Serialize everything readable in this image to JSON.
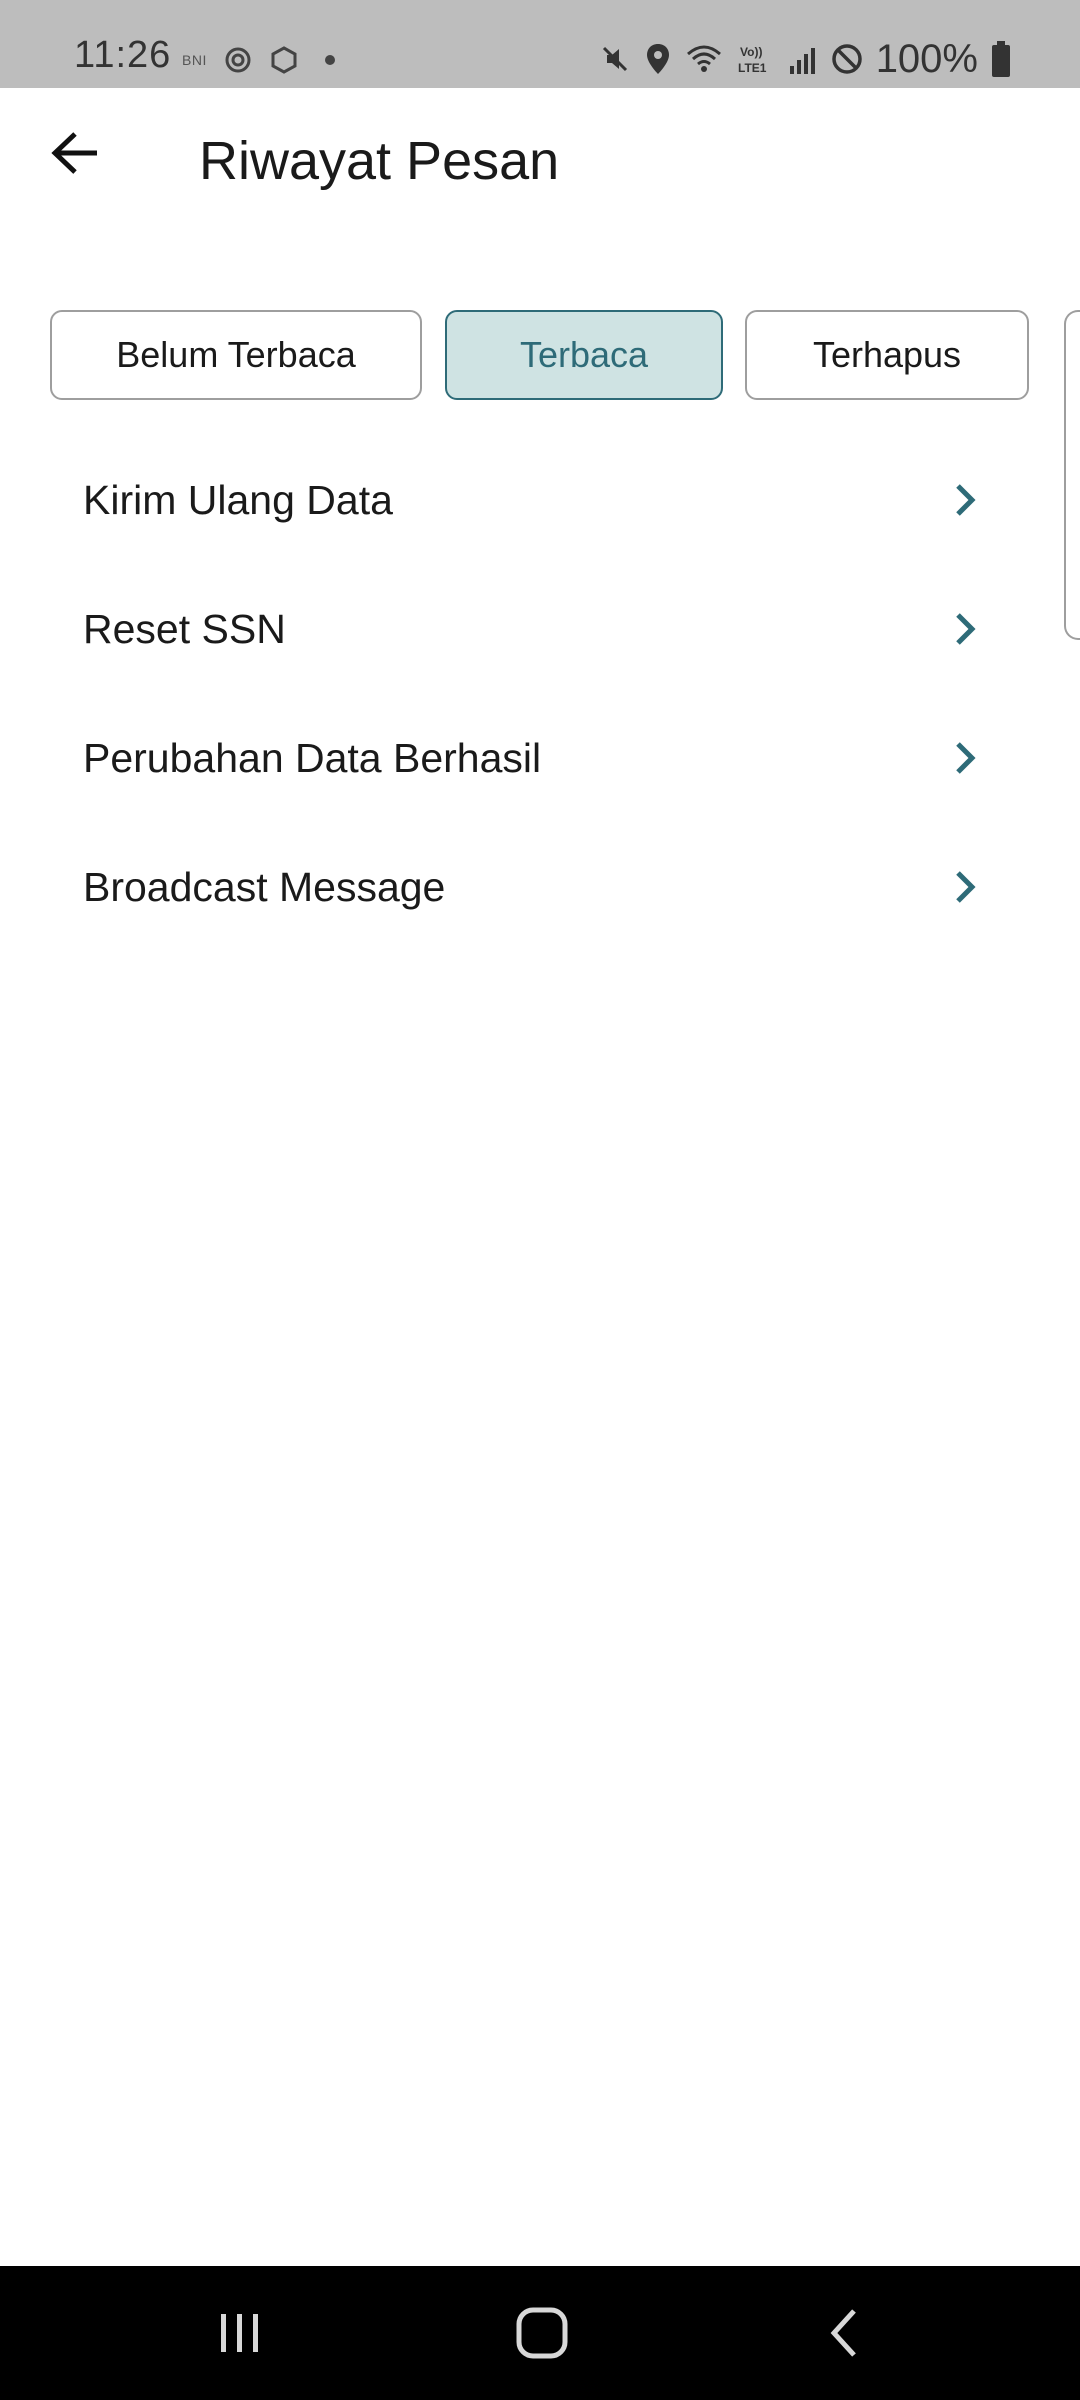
{
  "status_bar": {
    "time": "11:26",
    "bni_tag": "BNI",
    "battery_text": "100%",
    "icons": [
      "settings-gear-icon",
      "hexagon-app-icon",
      "notification-dot-icon",
      "mute-icon",
      "location-icon",
      "wifi-calling-icon",
      "volte-lte-icon",
      "signal-icon",
      "block-icon",
      "battery-icon"
    ]
  },
  "header": {
    "title": "Riwayat Pesan",
    "back_icon": "back-arrow-icon"
  },
  "tabs": [
    {
      "label": "Belum Terbaca",
      "active": false
    },
    {
      "label": "Terbaca",
      "active": true
    },
    {
      "label": "Terhapus",
      "active": false
    }
  ],
  "messages": [
    {
      "label": "Kirim Ulang Data"
    },
    {
      "label": "Reset SSN"
    },
    {
      "label": "Perubahan Data Berhasil"
    },
    {
      "label": "Broadcast Message"
    }
  ],
  "colors": {
    "accent": "#2e6b78",
    "active_tab_bg": "#cfe3e3",
    "status_bar_bg": "#bdbdbd",
    "nav_bar_bg": "#000000"
  },
  "nav_bar": {
    "icons": [
      "recent-apps-icon",
      "home-icon",
      "back-icon"
    ]
  }
}
